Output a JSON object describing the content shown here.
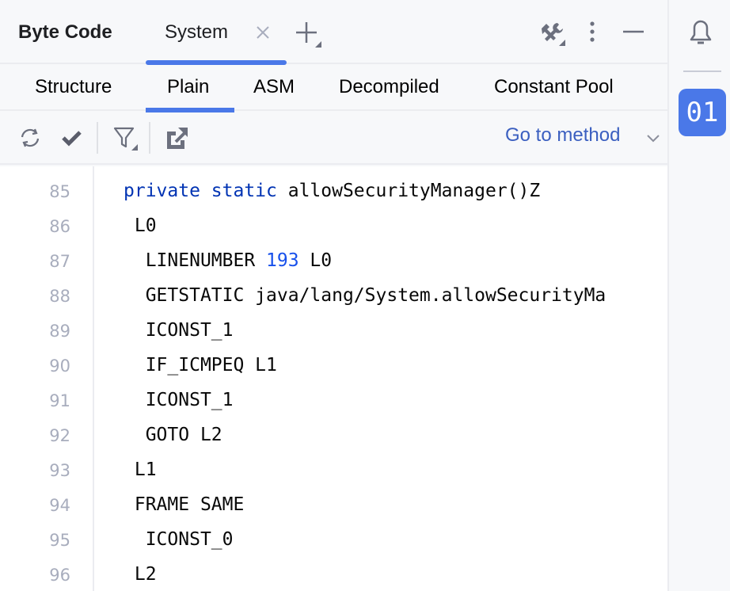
{
  "header": {
    "tool_title": "Byte Code",
    "file_tab": "System",
    "icons": [
      "close-tab-icon",
      "add-tab-icon",
      "build-tools-icon",
      "more-options-icon",
      "minimize-icon"
    ]
  },
  "view_tabs": [
    {
      "label": "Structure",
      "active": false
    },
    {
      "label": "Plain",
      "active": true
    },
    {
      "label": "ASM",
      "active": false
    },
    {
      "label": "Decompiled",
      "active": false
    },
    {
      "label": "Constant Pool",
      "active": false
    }
  ],
  "toolbar": {
    "icons": [
      "refresh-icon",
      "checkmark-icon",
      "filter-icon",
      "open-external-icon"
    ],
    "goto_label": "Go to method"
  },
  "editor": {
    "lines": [
      {
        "n": "85",
        "indent": "",
        "parts": [
          {
            "t": "private static ",
            "c": "kw"
          },
          {
            "t": "allowSecurityManager()Z",
            "c": ""
          }
        ]
      },
      {
        "n": "86",
        "indent": " ",
        "parts": [
          {
            "t": "L0",
            "c": ""
          }
        ]
      },
      {
        "n": "87",
        "indent": "  ",
        "parts": [
          {
            "t": "LINENUMBER ",
            "c": ""
          },
          {
            "t": "193",
            "c": "num"
          },
          {
            "t": " L0",
            "c": ""
          }
        ]
      },
      {
        "n": "88",
        "indent": "  ",
        "parts": [
          {
            "t": "GETSTATIC java/lang/System.allowSecurityMa",
            "c": ""
          }
        ]
      },
      {
        "n": "89",
        "indent": "  ",
        "parts": [
          {
            "t": "ICONST_1",
            "c": ""
          }
        ]
      },
      {
        "n": "90",
        "indent": "  ",
        "parts": [
          {
            "t": "IF_ICMPEQ L1",
            "c": ""
          }
        ]
      },
      {
        "n": "91",
        "indent": "  ",
        "parts": [
          {
            "t": "ICONST_1",
            "c": ""
          }
        ]
      },
      {
        "n": "92",
        "indent": "  ",
        "parts": [
          {
            "t": "GOTO L2",
            "c": ""
          }
        ]
      },
      {
        "n": "93",
        "indent": " ",
        "parts": [
          {
            "t": "L1",
            "c": ""
          }
        ]
      },
      {
        "n": "94",
        "indent": " ",
        "parts": [
          {
            "t": "FRAME SAME",
            "c": ""
          }
        ]
      },
      {
        "n": "95",
        "indent": "  ",
        "parts": [
          {
            "t": "ICONST_0",
            "c": ""
          }
        ]
      },
      {
        "n": "96",
        "indent": " ",
        "parts": [
          {
            "t": "L2",
            "c": ""
          }
        ]
      }
    ]
  },
  "right_strip": {
    "notifications_icon": "bell-icon",
    "bytecode_button_label": "01"
  },
  "colors": {
    "accent": "#4a78e8",
    "keyword": "#0033b3",
    "number": "#1750eb",
    "link": "#3b5fc0"
  }
}
